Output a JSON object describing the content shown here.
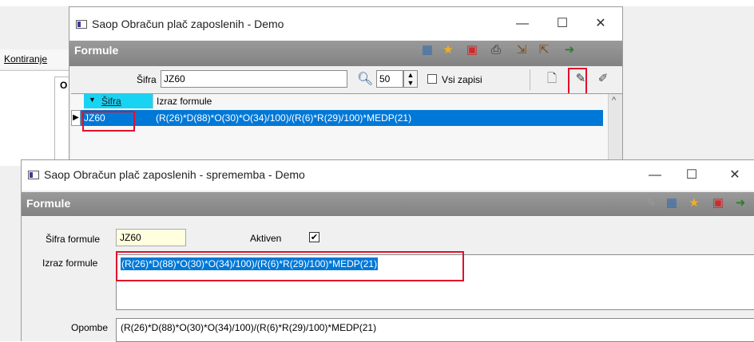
{
  "background": {
    "tab_label": "Kontiranje",
    "frame_label": "O"
  },
  "window1": {
    "title": "Saop Obračun plač zaposlenih - Demo",
    "header_title": "Formule",
    "controls": {
      "minimize": "—",
      "maximize": "☐",
      "close": "✕"
    },
    "filter": {
      "label": "Šifra",
      "value": "JZ60",
      "page_size": "50",
      "all_records_label": "Vsi zapisi",
      "all_records_checked": false
    },
    "grid": {
      "columns": [
        "Šifra",
        "Izraz formule"
      ],
      "rows": [
        {
          "code": "JZ60",
          "formula": "(R(26)*D(88)*O(30)*O(34)/100)/(R(6)*R(29)/100)*MEDP(21)"
        }
      ]
    }
  },
  "window2": {
    "title": "Saop Obračun plač zaposlenih - sprememba - Demo",
    "header_title": "Formule",
    "controls": {
      "minimize": "—",
      "maximize": "☐",
      "close": "✕"
    },
    "form": {
      "code_label": "Šifra formule",
      "code_value": "JZ60",
      "active_label": "Aktiven",
      "active_checked": true,
      "formula_label": "Izraz formule",
      "formula_value": "(R(26)*D(88)*O(30)*O(34)/100)/(R(6)*R(29)/100)*MEDP(21)",
      "notes_label": "Opombe",
      "notes_value": "(R(26)*D(88)*O(30)*O(34)/100)/(R(6)*R(29)/100)*MEDP(21)"
    }
  },
  "colors": {
    "header_gray": "#8c8c8c",
    "selection_blue": "#0078d7",
    "highlight_red": "#e0102a",
    "sort_column_cyan": "#19d3f3",
    "code_field_yellow": "#ffffe0"
  }
}
